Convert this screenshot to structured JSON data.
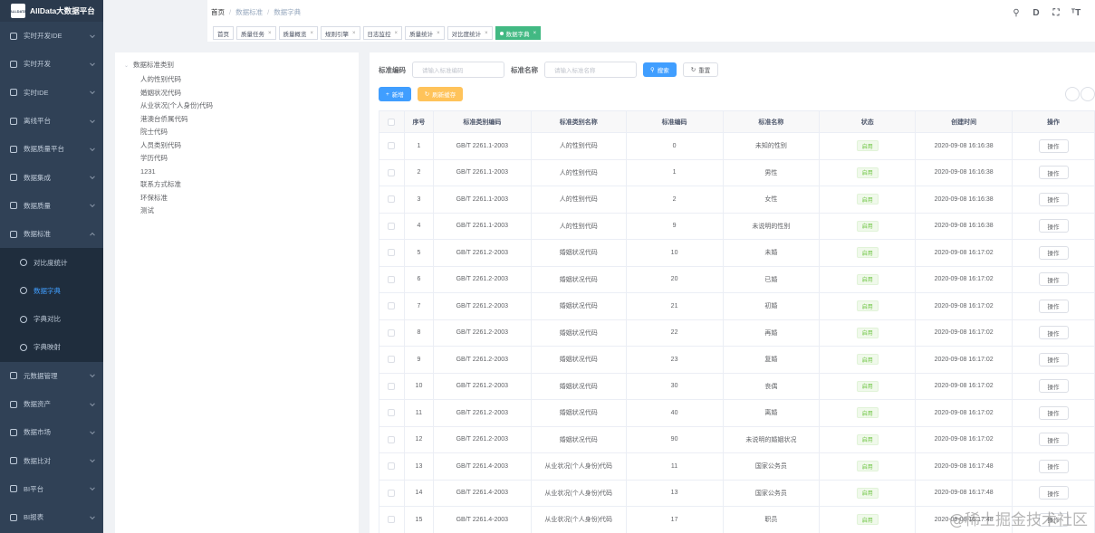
{
  "app": {
    "title": "AllData大数据平台",
    "logo_text": "ALLDATA"
  },
  "sidebar": {
    "items": [
      {
        "label": "实时开发IDE",
        "icon": "monitor-icon"
      },
      {
        "label": "实时开发",
        "icon": "monitor-icon"
      },
      {
        "label": "实时IDE",
        "icon": "send-icon"
      },
      {
        "label": "离线平台",
        "icon": "send-icon"
      },
      {
        "label": "数据质量平台",
        "icon": "user-icon"
      },
      {
        "label": "数据集成",
        "icon": "cube-icon"
      },
      {
        "label": "数据质量",
        "icon": "user-icon"
      },
      {
        "label": "数据标准",
        "icon": "send-icon"
      }
    ],
    "sub_items": [
      {
        "label": "对比度统计",
        "icon": "cube-icon"
      },
      {
        "label": "数据字典",
        "icon": "cube-icon"
      },
      {
        "label": "字典对比",
        "icon": "link-icon"
      },
      {
        "label": "字典映射",
        "icon": "user-icon"
      }
    ],
    "items_after": [
      {
        "label": "元数据管理",
        "icon": "send-icon"
      },
      {
        "label": "数据资产",
        "icon": "grid-icon"
      },
      {
        "label": "数据市场",
        "icon": "table-icon"
      },
      {
        "label": "数据比对",
        "icon": "grid-icon"
      },
      {
        "label": "BI平台",
        "icon": "bar-chart-icon"
      },
      {
        "label": "BI报表",
        "icon": "pie-chart-icon"
      }
    ]
  },
  "breadcrumb": [
    "首页",
    "数据标准",
    "数据字典"
  ],
  "tags": [
    {
      "label": "首页",
      "closable": false
    },
    {
      "label": "质量任务",
      "closable": true
    },
    {
      "label": "质量概览",
      "closable": true
    },
    {
      "label": "规则引擎",
      "closable": true
    },
    {
      "label": "日志监控",
      "closable": true
    },
    {
      "label": "质量统计",
      "closable": true
    },
    {
      "label": "对比度统计",
      "closable": true
    },
    {
      "label": "数据字典",
      "closable": true,
      "active": true
    }
  ],
  "header_icons": [
    "search-icon",
    "doc-icon",
    "fullscreen-icon",
    "font-size-icon"
  ],
  "tree": {
    "root": "数据标准类别",
    "children": [
      "人的性别代码",
      "婚姻状况代码",
      "从业状况(个人身份)代码",
      "港澳台侨属代码",
      "院士代码",
      "人员类别代码",
      "学历代码",
      "1231",
      "联系方式标准",
      "环保标准",
      "测试"
    ]
  },
  "search": {
    "code_label": "标准编码",
    "code_placeholder": "请输入标准编码",
    "name_label": "标准名称",
    "name_placeholder": "请输入标准名称",
    "search_btn": "搜索",
    "reset_btn": "重置"
  },
  "toolbar": {
    "add_btn": "新增",
    "refresh_btn": "刷新缓存"
  },
  "table": {
    "headers": [
      "序号",
      "标准类别编码",
      "标准类别名称",
      "标准编码",
      "标准名称",
      "状态",
      "创建时间",
      "操作"
    ],
    "rows": [
      [
        "1",
        "GB/T 2261.1-2003",
        "人的性别代码",
        "0",
        "未知的性别",
        "启用",
        "2020-09-08 16:16:38",
        "操作"
      ],
      [
        "2",
        "GB/T 2261.1-2003",
        "人的性别代码",
        "1",
        "男性",
        "启用",
        "2020-09-08 16:16:38",
        "操作"
      ],
      [
        "3",
        "GB/T 2261.1-2003",
        "人的性别代码",
        "2",
        "女性",
        "启用",
        "2020-09-08 16:16:38",
        "操作"
      ],
      [
        "4",
        "GB/T 2261.1-2003",
        "人的性别代码",
        "9",
        "未说明的性别",
        "启用",
        "2020-09-08 16:16:38",
        "操作"
      ],
      [
        "5",
        "GB/T 2261.2-2003",
        "婚姻状况代码",
        "10",
        "未婚",
        "启用",
        "2020-09-08 16:17:02",
        "操作"
      ],
      [
        "6",
        "GB/T 2261.2-2003",
        "婚姻状况代码",
        "20",
        "已婚",
        "启用",
        "2020-09-08 16:17:02",
        "操作"
      ],
      [
        "7",
        "GB/T 2261.2-2003",
        "婚姻状况代码",
        "21",
        "初婚",
        "启用",
        "2020-09-08 16:17:02",
        "操作"
      ],
      [
        "8",
        "GB/T 2261.2-2003",
        "婚姻状况代码",
        "22",
        "再婚",
        "启用",
        "2020-09-08 16:17:02",
        "操作"
      ],
      [
        "9",
        "GB/T 2261.2-2003",
        "婚姻状况代码",
        "23",
        "复婚",
        "启用",
        "2020-09-08 16:17:02",
        "操作"
      ],
      [
        "10",
        "GB/T 2261.2-2003",
        "婚姻状况代码",
        "30",
        "丧偶",
        "启用",
        "2020-09-08 16:17:02",
        "操作"
      ],
      [
        "11",
        "GB/T 2261.2-2003",
        "婚姻状况代码",
        "40",
        "离婚",
        "启用",
        "2020-09-08 16:17:02",
        "操作"
      ],
      [
        "12",
        "GB/T 2261.2-2003",
        "婚姻状况代码",
        "90",
        "未说明的婚姻状况",
        "启用",
        "2020-09-08 16:17:02",
        "操作"
      ],
      [
        "13",
        "GB/T 2261.4-2003",
        "从业状况(个人身份)代码",
        "11",
        "国家公务员",
        "启用",
        "2020-09-08 16:17:48",
        "操作"
      ],
      [
        "14",
        "GB/T 2261.4-2003",
        "从业状况(个人身份)代码",
        "13",
        "国家公务员",
        "启用",
        "2020-09-08 16:17:48",
        "操作"
      ],
      [
        "15",
        "GB/T 2261.4-2003",
        "从业状况(个人身份)代码",
        "17",
        "职员",
        "启用",
        "2020-09-08 16:17:48",
        "操作"
      ]
    ]
  },
  "watermark": "@稀土掘金技术社区",
  "colors": {
    "sidebar_bg": "#304156",
    "primary": "#409eff",
    "warning": "#ffc35a",
    "success": "#67c23a",
    "active_tag": "#42b983"
  }
}
